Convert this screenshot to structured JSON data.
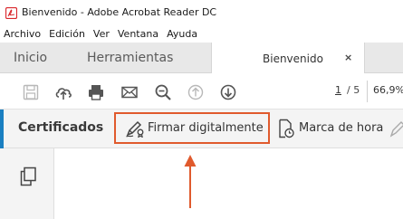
{
  "window": {
    "title": "Bienvenido - Adobe Acrobat Reader DC"
  },
  "menu": [
    "Archivo",
    "Edición",
    "Ver",
    "Ventana",
    "Ayuda"
  ],
  "tabs": {
    "home": "Inicio",
    "tools": "Herramientas",
    "document": "Bienvenido",
    "close_glyph": "×"
  },
  "toolbar": {
    "page_current": "1",
    "page_separator": "/ 5",
    "zoom": "66,9%"
  },
  "cert_bar": {
    "title": "Certificados",
    "sign_label": "Firmar digitalmente",
    "timestamp_label": "Marca de hora"
  },
  "colors": {
    "highlight": "#e05a2d",
    "accent": "#1a7fc1",
    "pdf_red": "#d9262b"
  },
  "icons": [
    "pdf-app-icon",
    "save-icon",
    "upload-cloud-icon",
    "print-icon",
    "email-icon",
    "zoom-out-icon",
    "page-up-icon",
    "page-down-icon",
    "sign-pen-icon",
    "timestamp-icon",
    "pen-icon",
    "pages-icon",
    "callout-arrow"
  ]
}
